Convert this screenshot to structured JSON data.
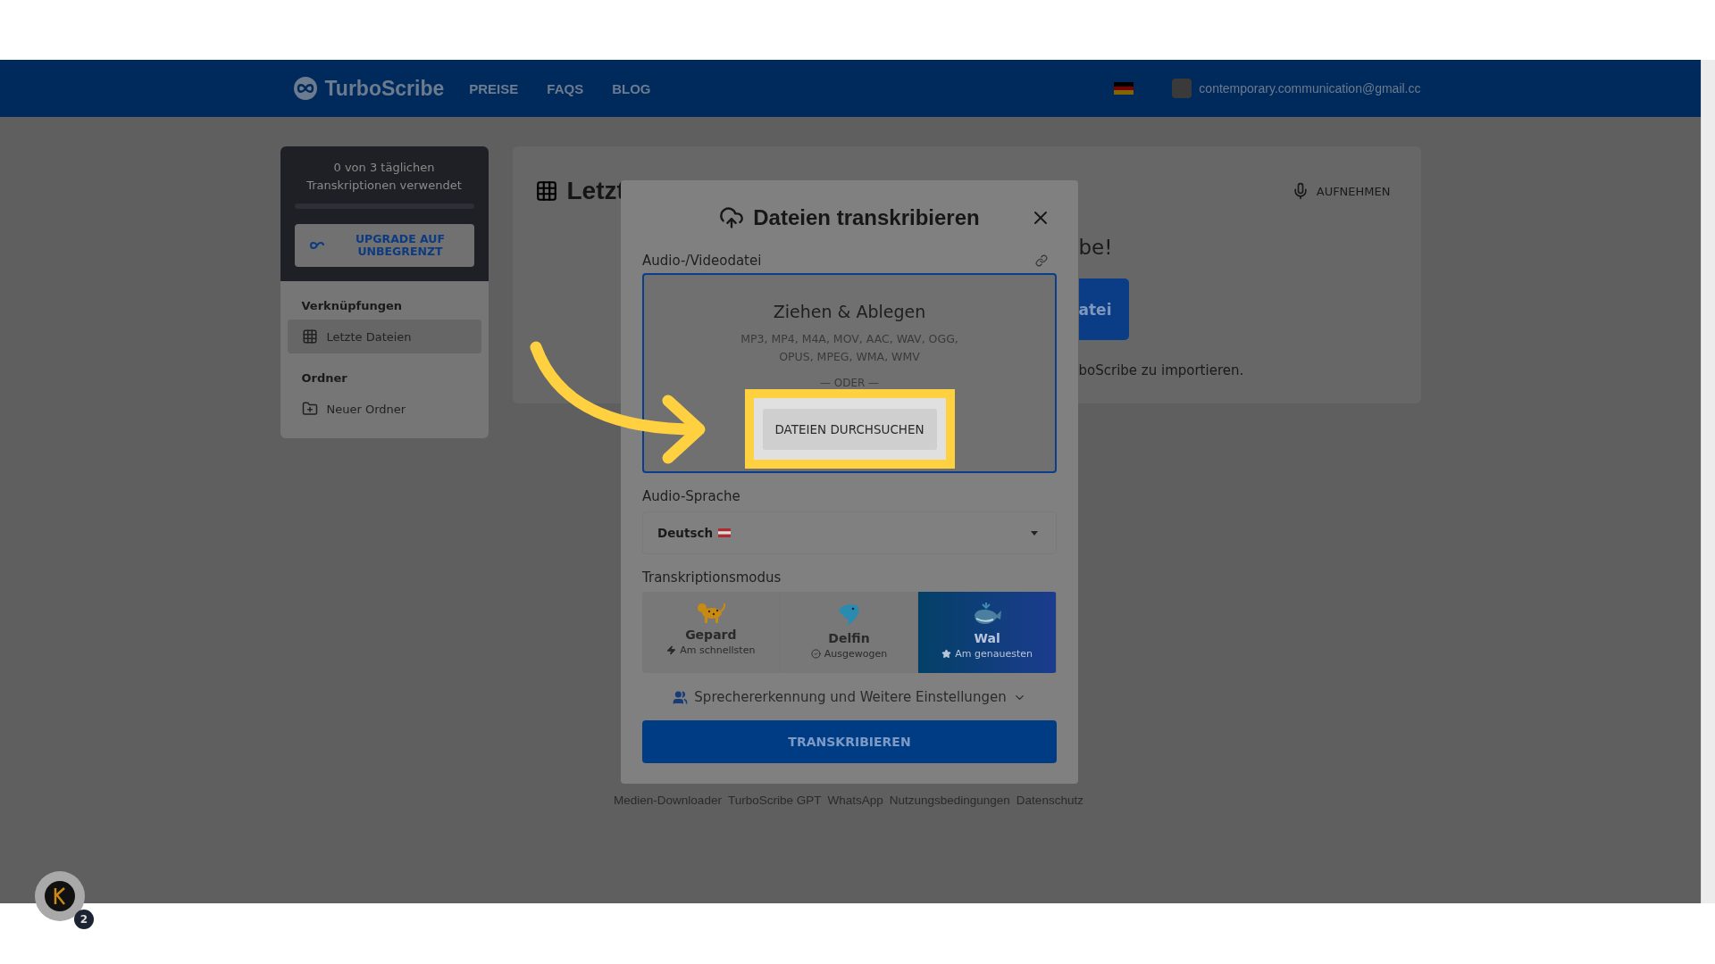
{
  "header": {
    "logo": "TurboScribe",
    "nav": [
      "PREISE",
      "FAQS",
      "BLOG"
    ],
    "email": "contemporary.communication@gmail.cc"
  },
  "sidebar": {
    "usage": "0 von 3 täglichen Transkriptionen verwendet",
    "level": 0,
    "upgrade_button": "UPGRADE AUF UNBEGRENZT",
    "sections": [
      {
        "title": "Verknüpfungen",
        "items": [
          {
            "label": "Letzte Dateien",
            "kind": "grid",
            "selected": true
          }
        ]
      },
      {
        "title": "Ordner",
        "items": [
          {
            "label": "Neuer Ordner",
            "kind": "new-folder",
            "selected": false
          }
        ]
      }
    ]
  },
  "main": {
    "title": "Letzt",
    "record_button": "AUFNEHMEN",
    "heading_fragment": "be!",
    "button_fragment": "atei",
    "text_fragment": "boScribe zu importieren."
  },
  "modal": {
    "title": "Dateien transkribieren",
    "file_label": "Audio-/Videodatei",
    "dropzone": {
      "title": "Ziehen & Ablegen",
      "formats": "MP3, MP4, M4A, MOV, AAC, WAV, OGG, OPUS, MPEG, WMA, WMV",
      "separator": "— ODER —",
      "browse_button": "DATEIEN DURCHSUCHEN"
    },
    "language_label": "Audio-Sprache",
    "language": "Deutsch",
    "mode_label": "Transkriptionsmodus",
    "modes": [
      {
        "name": "Gepard",
        "hint": "Am schnellsten",
        "kind": "cheetah",
        "selected": false
      },
      {
        "name": "Delfin",
        "hint": "Ausgewogen",
        "kind": "dolphin",
        "selected": false
      },
      {
        "name": "Wal",
        "hint": "Am genauesten",
        "kind": "whale",
        "selected": true
      }
    ],
    "settings_link": "Sprechererkennung und Weitere Einstellungen",
    "submit_button": "TRANSKRIBIEREN"
  },
  "footer_links": [
    "Medien-Downloader",
    "TurboScribe GPT",
    "WhatsApp",
    "Nutzungsbedingungen",
    "Datenschutz"
  ],
  "chat_badge": "2"
}
